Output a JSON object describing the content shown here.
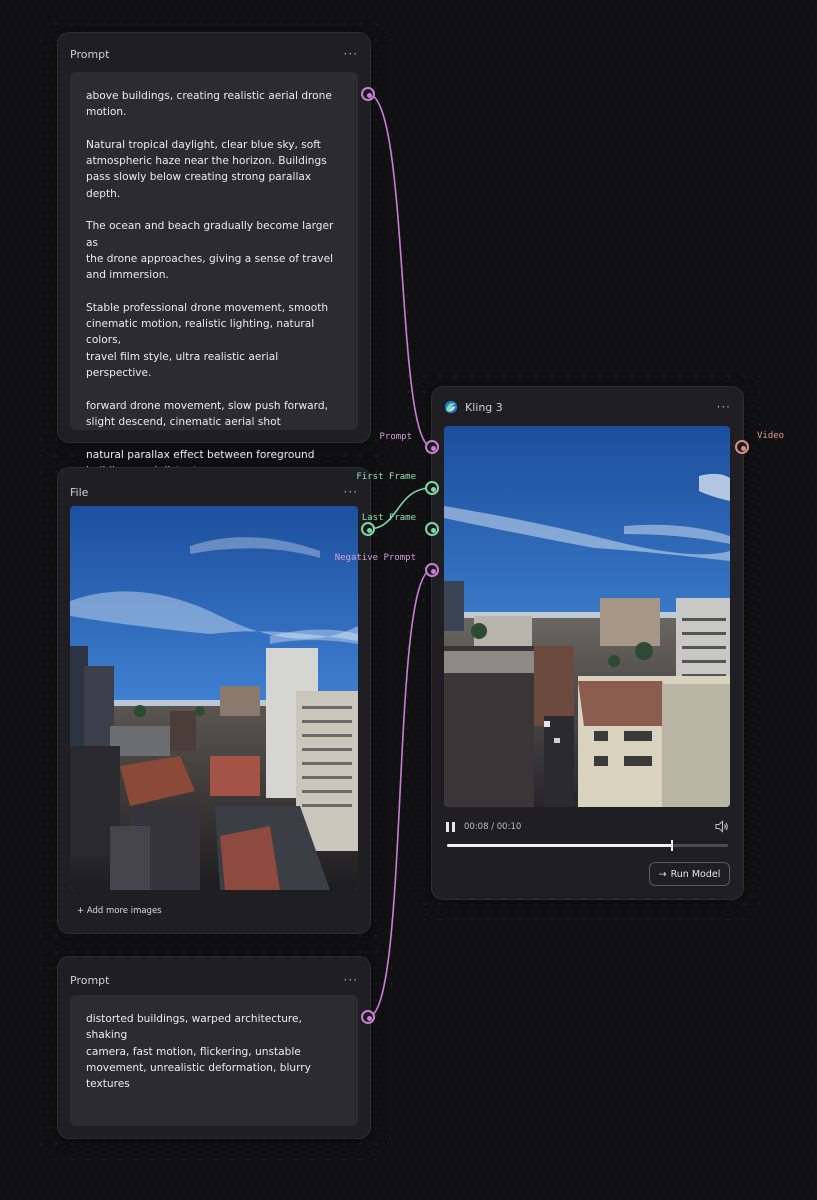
{
  "nodes": {
    "prompt_top": {
      "title": "Prompt",
      "menu": "···",
      "paragraphs": [
        "above buildings, creating realistic aerial drone\nmotion.",
        "Natural tropical daylight, clear blue sky, soft\natmospheric haze near the horizon. Buildings\npass slowly below creating strong parallax depth.",
        "The ocean and beach gradually become larger as\nthe drone approaches, giving a sense of travel\nand immersion.",
        "Stable professional drone movement, smooth\ncinematic motion, realistic lighting, natural colors,\ntravel film style, ultra realistic aerial perspective.",
        "forward drone movement, slow push forward,\nslight descend, cinematic aerial shot",
        "natural parallax effect between foreground\nbuildings and distant ocean"
      ]
    },
    "file": {
      "title": "File",
      "menu": "···",
      "add_more": "+ Add more images"
    },
    "prompt_bottom": {
      "title": "Prompt",
      "menu": "···",
      "paragraphs": [
        "distorted buildings, warped architecture, shaking\ncamera, fast motion, flickering, unstable\nmovement, unrealistic deformation, blurry\ntextures"
      ]
    },
    "kling": {
      "title": "Kling 3",
      "menu": "···",
      "inputs": [
        "Prompt",
        "First Frame",
        "Last Frame",
        "Negative Prompt"
      ],
      "output": "Video",
      "time": "00:08 / 00:10",
      "progress": 0.8,
      "run_label": "Run Model",
      "run_icon": "→"
    }
  },
  "colors": {
    "prompt_port": "#c77fd6",
    "image_port": "#7fd6a4",
    "video_port": "#d88f84"
  },
  "icons": [
    "pause-icon",
    "volume-icon",
    "arrow-right-icon",
    "kling-logo-icon"
  ]
}
